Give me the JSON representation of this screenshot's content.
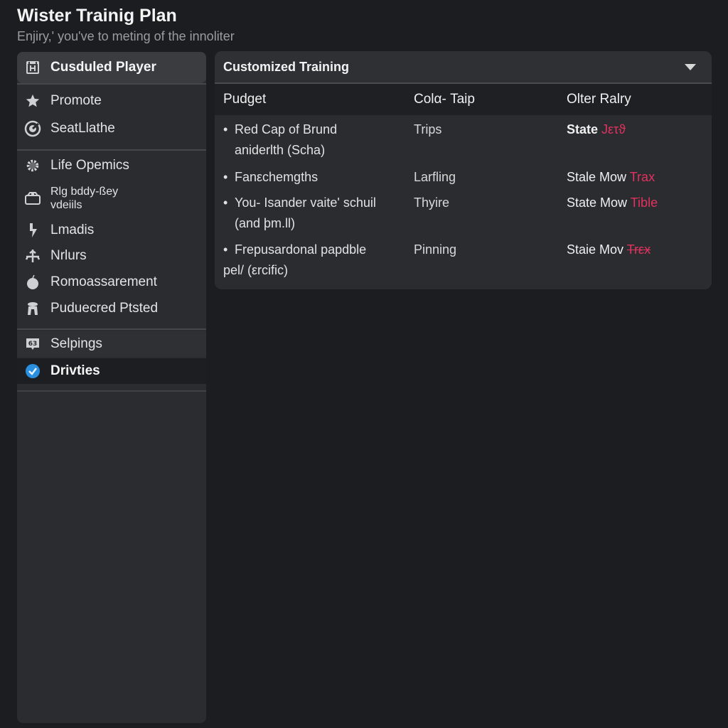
{
  "header": {
    "title": "Wister Trainig Plan",
    "subtitle": "Enjiry,' you've to meting of the innoliter"
  },
  "sidebar": {
    "selected": {
      "label": "Cusduled Player",
      "icon": "calendar-icon"
    },
    "group1": [
      {
        "label": "Promote",
        "icon": "star-icon"
      },
      {
        "label": "SeatLlathe",
        "icon": "target-icon"
      }
    ],
    "group2": [
      {
        "label": "Life Opemics",
        "icon": "gear-icon"
      },
      {
        "label_line1": "Rlg bddy-ßey",
        "label_line2": "vdeiils",
        "icon": "box-icon"
      },
      {
        "label": "Lmadis",
        "icon": "lightning-icon"
      },
      {
        "label": "Nrlurs",
        "icon": "anchor-icon"
      },
      {
        "label": "Romoassarement",
        "icon": "apple-icon"
      },
      {
        "label": "Puduecred Ptsted",
        "icon": "figure-icon"
      }
    ],
    "group3": [
      {
        "label": "Selpings",
        "icon": "badge-icon"
      },
      {
        "label": "Drivties",
        "icon": "check-circle-icon",
        "active": true
      }
    ]
  },
  "panel": {
    "title": "Customized Training",
    "dropdown_icon": "caret-down-icon",
    "columns": [
      "Pudget",
      "Colα- Taip",
      "Olter Ralry"
    ],
    "rows": [
      {
        "c1_line1": "Red Cap of Brund",
        "c1_line2": "aniderlth (Scha)",
        "c2": "Trips",
        "c3_text": "State",
        "c3_accent": "Jετϑ"
      },
      {
        "c1_line1": "Fanεchemgths",
        "c1_line2": "",
        "c2": "Larfling",
        "c3_text": "Stale Mow",
        "c3_accent": "Trax"
      },
      {
        "c1_line1": "You- Isander vaite' schuil",
        "c1_line2": "(and þm.ll)",
        "c2": "Thyire",
        "c3_text": "State Mow",
        "c3_accent": "Tible"
      },
      {
        "c1_line1": "Frepusardonal papdble",
        "c1_line2": "pel/ (εrcific)",
        "c2": "Pinning",
        "c3_text": "Staie Mov",
        "c3_accent": "Trεx"
      }
    ]
  },
  "colors": {
    "accent": "#e2325f",
    "active_icon": "#2b8fe0",
    "background": "#1b1d20",
    "panel": "#2a2c30"
  }
}
